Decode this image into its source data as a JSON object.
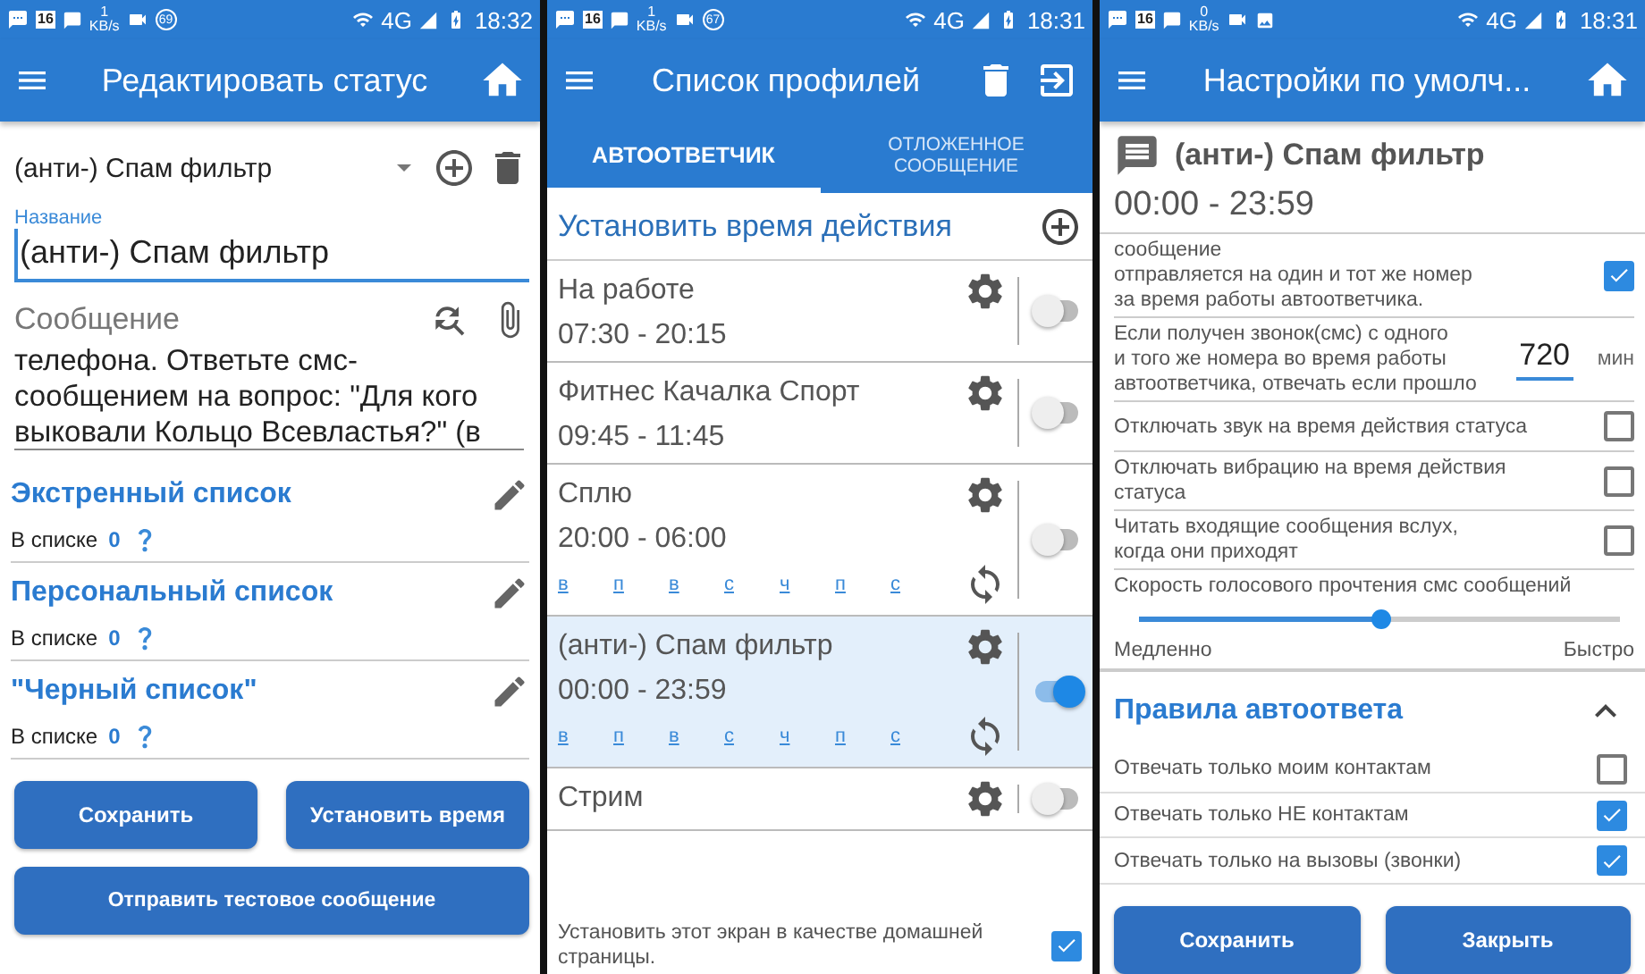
{
  "edit_status": {
    "status_bar": {
      "calendar_day": "16",
      "speed": "1",
      "speed_unit": "KB/s",
      "badge": "69",
      "network": "4G",
      "time": "18:32"
    },
    "app_bar": {
      "title": "Редактировать статус"
    },
    "profile_select": {
      "value": "(анти-) Спам фильтр"
    },
    "name_field": {
      "label": "Название",
      "value": "(анти-) Спам фильтр"
    },
    "message_field": {
      "label": "Сообщение",
      "value": "телефона. Ответьте смс-сообщением на вопрос: \"Для кого выковали Кольцо Всевластья?\" (в"
    },
    "lists": [
      {
        "title": "Экстренный список",
        "count_label": "В списке",
        "count": "0"
      },
      {
        "title": "Персональный список",
        "count_label": "В списке",
        "count": "0"
      },
      {
        "title": "\"Черный список\"",
        "count_label": "В списке",
        "count": "0"
      }
    ],
    "buttons": [
      "Сохранить",
      "Установить время"
    ],
    "test_button": "Отправить тестовое сообщение"
  },
  "profile_list": {
    "status_bar": {
      "calendar_day": "16",
      "speed": "1",
      "speed_unit": "KB/s",
      "badge": "67",
      "network": "4G",
      "time": "18:31"
    },
    "app_bar": {
      "title": "Список профилей"
    },
    "tabs": [
      {
        "label": "АВТООТВЕТЧИК",
        "selected": true
      },
      {
        "label": "ОТЛОЖЕННОЕ СООБЩЕНИЕ",
        "selected": false
      }
    ],
    "set_time": "Установить время действия",
    "profiles": [
      {
        "name": "На работе",
        "time": "07:30 - 20:15",
        "on": false,
        "selected": false
      },
      {
        "name": "Фитнес Качалка Спорт",
        "time": "09:45 - 11:45",
        "on": false,
        "selected": false
      },
      {
        "name": "Сплю",
        "time": "20:00 - 06:00",
        "days": [
          "в",
          "п",
          "в",
          "с",
          "ч",
          "п",
          "с"
        ],
        "on": false,
        "selected": false
      },
      {
        "name": "(анти-) Спам фильтр",
        "time": "00:00 - 23:59",
        "days": [
          "в",
          "п",
          "в",
          "с",
          "ч",
          "п",
          "с"
        ],
        "on": true,
        "selected": true
      },
      {
        "name": "Стрим",
        "on": false,
        "selected": false
      }
    ],
    "home_option": {
      "label": "Установить этот экран в качестве домашней страницы.",
      "checked": true
    }
  },
  "default_settings": {
    "status_bar": {
      "calendar_day": "16",
      "speed": "0",
      "speed_unit": "KB/s",
      "network": "4G",
      "time": "18:31"
    },
    "app_bar": {
      "title": "Настройки по умолч..."
    },
    "profile": {
      "name": "(анти-) Спам фильтр",
      "time": "00:00 - 23:59"
    },
    "settings": [
      {
        "kind": "checkbox",
        "label": "сообщение\nотправляется на один и тот же номер\n за время работы автоответчика.",
        "checked": true
      },
      {
        "kind": "number",
        "label": "Если получен звонок(смс) с одного\nи того же номера во время работы\nавтоответчика, отвечать если прошло",
        "value": "720",
        "unit": "мин"
      },
      {
        "kind": "checkbox",
        "label": "Отключать звук на время действия статуса",
        "checked": false
      },
      {
        "kind": "checkbox",
        "label": "Отключать вибрацию на время действия\nстатуса",
        "checked": false
      },
      {
        "kind": "checkbox",
        "label": "Читать входящие сообщения вслух,\n когда они приходят",
        "checked": false
      },
      {
        "kind": "slider",
        "label": "Скорость голосового прочтения смс сообщений",
        "level": 0.5,
        "min_label": "Медленно",
        "max_label": "Быстро"
      }
    ],
    "rules": {
      "title": "Правила автоответа",
      "expanded": true,
      "items": [
        {
          "label": "Отвечать только моим контактам",
          "checked": false
        },
        {
          "label": "Отвечать только НЕ контактам",
          "checked": true
        },
        {
          "label": "Отвечать только на вызовы (звонки)",
          "checked": true
        }
      ]
    },
    "buttons": [
      "Сохранить",
      "Закрыть"
    ]
  }
}
